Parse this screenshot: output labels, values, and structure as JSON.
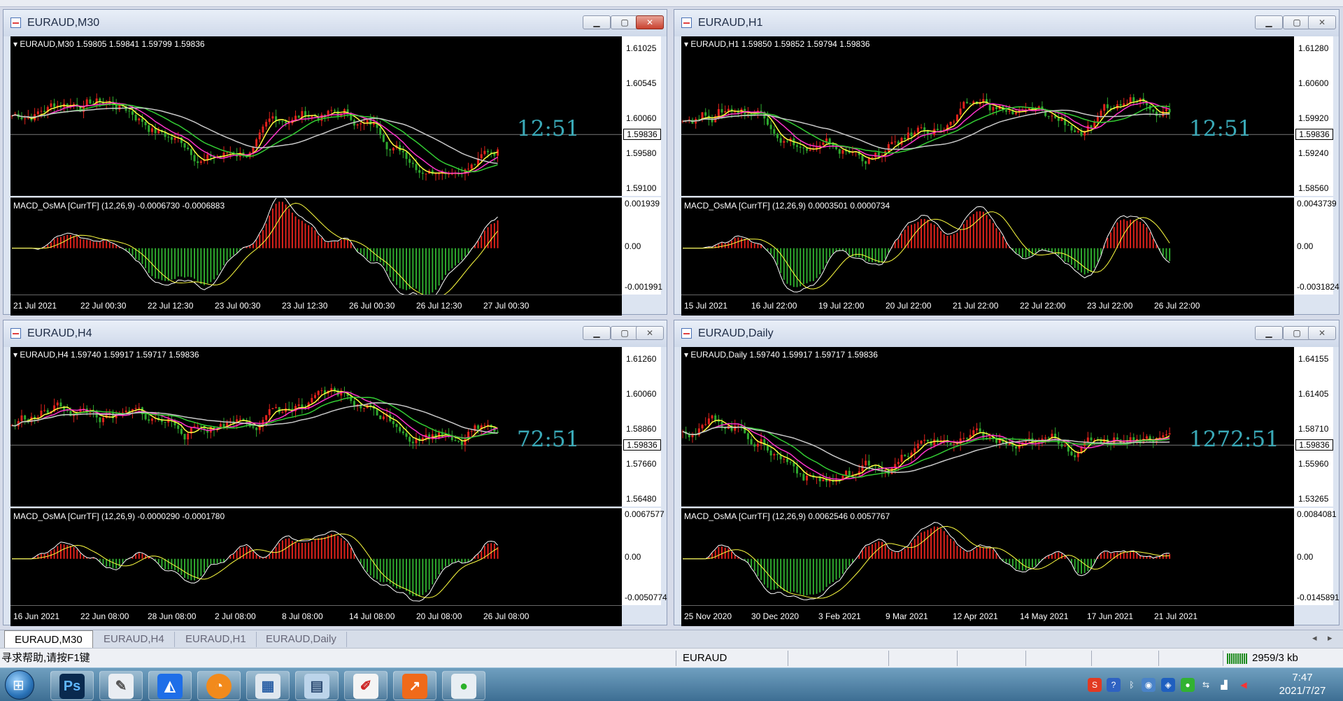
{
  "windows": [
    {
      "title": "EURAUD,M30",
      "symbol_line": "EURAUD,M30  1.59805 1.59841 1.59799 1.59836",
      "price_labels": [
        "1.61025",
        "1.60545",
        "1.60060",
        "1.59580",
        "1.59100"
      ],
      "current_price": "1.59836",
      "countdown": "12:51",
      "indicator_line": "MACD_OsMA [CurrTF] (12,26,9) -0.0006730 -0.0006883",
      "indicator_labels": [
        "0.001939",
        "0.00",
        "-0.001991"
      ],
      "time_labels": [
        "21 Jul 2021",
        "22 Jul 00:30",
        "22 Jul 12:30",
        "23 Jul 00:30",
        "23 Jul 12:30",
        "26 Jul 00:30",
        "26 Jul 12:30",
        "27 Jul 00:30"
      ],
      "active": true
    },
    {
      "title": "EURAUD,H1",
      "symbol_line": "EURAUD,H1  1.59850 1.59852 1.59794 1.59836",
      "price_labels": [
        "1.61280",
        "1.60600",
        "1.59920",
        "1.59240",
        "1.58560"
      ],
      "current_price": "1.59836",
      "countdown": "12:51",
      "indicator_line": "MACD_OsMA [CurrTF] (12,26,9) 0.0003501 0.0000734",
      "indicator_labels": [
        "0.0043739",
        "0.00",
        "-0.0031824"
      ],
      "time_labels": [
        "15 Jul 2021",
        "16 Jul 22:00",
        "19 Jul 22:00",
        "20 Jul 22:00",
        "21 Jul 22:00",
        "22 Jul 22:00",
        "23 Jul 22:00",
        "26 Jul 22:00"
      ],
      "active": false
    },
    {
      "title": "EURAUD,H4",
      "symbol_line": "EURAUD,H4  1.59740 1.59917 1.59717 1.59836",
      "price_labels": [
        "1.61260",
        "1.60060",
        "1.58860",
        "1.57660",
        "1.56480"
      ],
      "current_price": "1.59836",
      "countdown": "72:51",
      "indicator_line": "MACD_OsMA [CurrTF] (12,26,9) -0.0000290 -0.0001780",
      "indicator_labels": [
        "0.0067577",
        "0.00",
        "-0.0050774"
      ],
      "time_labels": [
        "16 Jun 2021",
        "22 Jun 08:00",
        "28 Jun 08:00",
        "2 Jul 08:00",
        "8 Jul 08:00",
        "14 Jul 08:00",
        "20 Jul 08:00",
        "26 Jul 08:00"
      ],
      "active": false
    },
    {
      "title": "EURAUD,Daily",
      "symbol_line": "EURAUD,Daily  1.59740 1.59917 1.59717 1.59836",
      "price_labels": [
        "1.64155",
        "1.61405",
        "1.58710",
        "1.55960",
        "1.53265"
      ],
      "current_price": "1.59836",
      "countdown": "1272:51",
      "indicator_line": "MACD_OsMA [CurrTF] (12,26,9) 0.0062546 0.0057767",
      "indicator_labels": [
        "0.0084081",
        "0.00",
        "-0.0145891"
      ],
      "time_labels": [
        "25 Nov 2020",
        "30 Dec 2020",
        "3 Feb 2021",
        "9 Mar 2021",
        "12 Apr 2021",
        "14 May 2021",
        "17 Jun 2021",
        "21 Jul 2021"
      ],
      "active": false
    }
  ],
  "window_buttons": {
    "minimize": "▁",
    "maximize": "▢",
    "close": "✕"
  },
  "tabs": [
    "EURAUD,M30",
    "EURAUD,H4",
    "EURAUD,H1",
    "EURAUD,Daily"
  ],
  "active_tab": 0,
  "tab_scroll": {
    "left": "◂",
    "right": "▸"
  },
  "status": {
    "help": "寻求帮助,请按F1键",
    "profile": "EURAUD",
    "traffic": "2959/3 kb"
  },
  "taskbar": {
    "apps": [
      "start-menu",
      "photoshop",
      "pen-tool",
      "feishu",
      "browser-orange",
      "control-panel",
      "notepad",
      "paint",
      "chart-app",
      "wechat"
    ],
    "ps_label": "Ps",
    "time": "7:47",
    "date": "2021/7/27"
  },
  "colors": {
    "up_bar": "#e0221c",
    "down_bar": "#2ea82e",
    "ma_fast": "#ffff40",
    "ma_mid": "#ff33cc",
    "ma_slow": "#33cc33",
    "ma_long": "#c8c8c8",
    "countdown": "#3aa9b7"
  }
}
